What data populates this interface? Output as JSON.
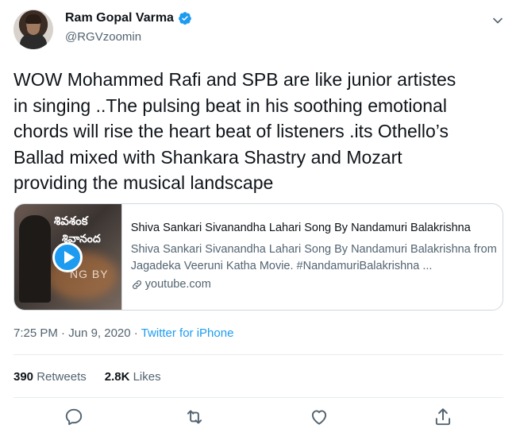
{
  "author": {
    "name": "Ram Gopal Varma",
    "handle": "@RGVzoomin",
    "verified_color": "#1d9bf0"
  },
  "tweet": {
    "text": "WOW Mohammed Rafi and SPB are like junior artistes\nin singing ..The pulsing beat in his soothing emotional\nchords will rise the heart beat of listeners  .its Othello’s\nBallad mixed with Shankara Shastry and Mozart\nproviding the musical landscape"
  },
  "card": {
    "thumbnail_text_line1": "శివశంక",
    "thumbnail_text_line2": "శివానంద",
    "thumbnail_text_line3": "NG BY",
    "title": "Shiva Sankari Sivanandha Lahari Song By Nandamuri Balakrishna",
    "description": "Shiva Sankari Sivanandha Lahari Song By Nandamuri Balakrishna from Jagadeka Veeruni Katha Movie. #NandamuriBalakrishna ...",
    "domain": "youtube.com"
  },
  "meta": {
    "time": "7:25 PM",
    "date": "Jun 9, 2020",
    "separator": "·",
    "source": "Twitter for iPhone"
  },
  "stats": {
    "retweets_count": "390",
    "retweets_label": "Retweets",
    "likes_count": "2.8K",
    "likes_label": "Likes"
  },
  "icons": {
    "reply": "reply-icon",
    "retweet": "retweet-icon",
    "like": "like-icon",
    "share": "share-icon",
    "accent": "#1d9bf0",
    "icon_gray": "#536471"
  }
}
